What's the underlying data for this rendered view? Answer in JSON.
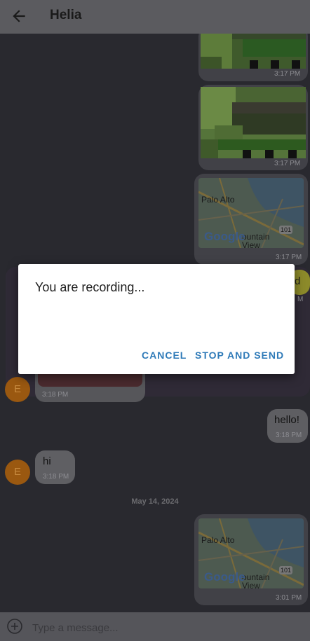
{
  "header": {
    "title": "Helia",
    "back_icon": "arrow-left-icon"
  },
  "messages": {
    "img1_time": "3:17 PM",
    "img2_time": "3:17 PM",
    "map1": {
      "label_city1": "Palo Alto",
      "label_city2": "ountain View",
      "label_route": "101",
      "logo": "Google",
      "time": "3:17 PM"
    },
    "partial_right_text": "d",
    "partial_right_time": "M",
    "recv_image_time": "3:18 PM",
    "hello": {
      "text": "hello!",
      "time": "3:18 PM"
    },
    "hi": {
      "text": "hi",
      "time": "3:18 PM"
    },
    "date_separator": "May 14, 2024",
    "map2": {
      "label_city1": "Palo Alto",
      "label_city2": "ountain View",
      "label_route": "101",
      "logo": "Google",
      "time": "3:01 PM"
    },
    "avatar_initial": "E"
  },
  "dialog": {
    "title": "You are recording...",
    "cancel_label": "CANCEL",
    "stop_label": "STOP AND SEND"
  },
  "composer": {
    "placeholder": "Type a message...",
    "add_icon": "plus-circle-icon"
  }
}
